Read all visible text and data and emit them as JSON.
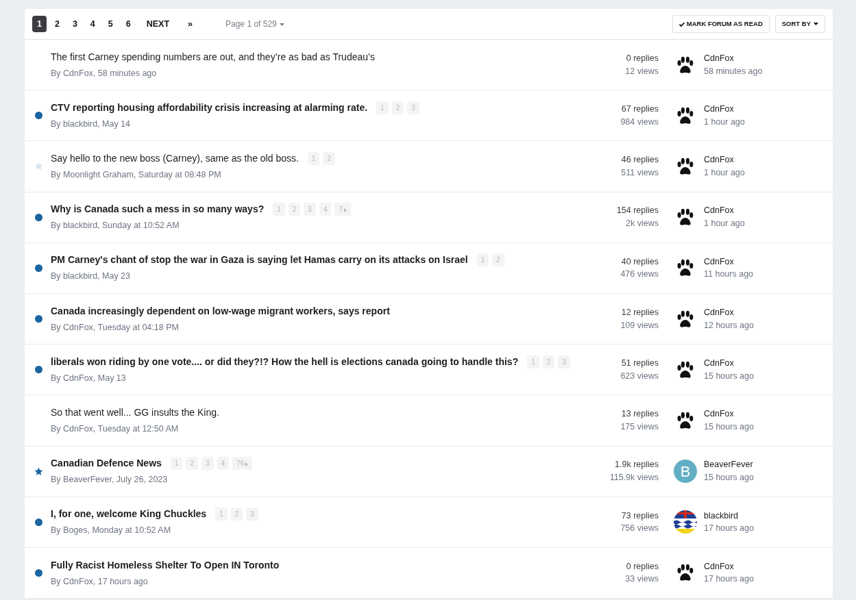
{
  "pagination": {
    "pages": [
      {
        "label": "1",
        "selected": true
      },
      {
        "label": "2",
        "selected": false
      },
      {
        "label": "3",
        "selected": false
      },
      {
        "label": "4",
        "selected": false
      },
      {
        "label": "5",
        "selected": false
      },
      {
        "label": "6",
        "selected": false
      }
    ],
    "next": "NEXT",
    "last": "»",
    "page_jump": "Page 1 of 529"
  },
  "actions": {
    "mark_read": "MARK FORUM AS READ",
    "sort": "SORT BY"
  },
  "topics": [
    {
      "title": "The first Carney spending numbers are out, and they’re as bad as Trudeau’s",
      "unread": false,
      "followed": false,
      "author": "By CdnFox, 58 minutes ago",
      "replies": "0 replies",
      "views": "12 views",
      "avatar": {
        "kind": "paw"
      },
      "last_poster": "CdnFox",
      "last_time": "58 minutes ago"
    },
    {
      "title": "CTV reporting housing affordability crisis increasing at alarming rate.",
      "unread": true,
      "followed": false,
      "author": "By blackbird, May 14",
      "pages": [
        "1",
        "2",
        "3"
      ],
      "replies": "67 replies",
      "views": "984 views",
      "avatar": {
        "kind": "paw"
      },
      "last_poster": "CdnFox",
      "last_time": "1 hour ago"
    },
    {
      "title": "Say hello to the new boss (Carney), same as the old boss.",
      "unread": false,
      "followed": true,
      "author": "By Moonlight Graham, Saturday at 08:48 PM",
      "pages": [
        "1",
        "2"
      ],
      "replies": "46 replies",
      "views": "511 views",
      "avatar": {
        "kind": "paw"
      },
      "last_poster": "CdnFox",
      "last_time": "1 hour ago"
    },
    {
      "title": "Why is Canada such a mess in so many ways?",
      "unread": true,
      "followed": false,
      "author": "By blackbird, Sunday at 10:52 AM",
      "pages": [
        "1",
        "2",
        "3",
        "4"
      ],
      "more_page": "7",
      "replies": "154 replies",
      "views": "2k views",
      "avatar": {
        "kind": "paw"
      },
      "last_poster": "CdnFox",
      "last_time": "1 hour ago"
    },
    {
      "title": "PM Carney's chant of stop the war in Gaza is saying let Hamas carry on its attacks on Israel",
      "unread": true,
      "followed": false,
      "author": "By blackbird, May 23",
      "pages": [
        "1",
        "2"
      ],
      "replies": "40 replies",
      "views": "476 views",
      "avatar": {
        "kind": "paw"
      },
      "last_poster": "CdnFox",
      "last_time": "11 hours ago"
    },
    {
      "title": "Canada increasingly dependent on low-wage migrant workers, says report",
      "unread": true,
      "followed": false,
      "author": "By CdnFox, Tuesday at 04:18 PM",
      "replies": "12 replies",
      "views": "109 views",
      "avatar": {
        "kind": "paw"
      },
      "last_poster": "CdnFox",
      "last_time": "12 hours ago"
    },
    {
      "title": "liberals won riding by one vote.... or did they?!? How the hell is elections canada going to handle this?",
      "unread": true,
      "followed": false,
      "author": "By CdnFox, May 13",
      "pages": [
        "1",
        "2",
        "3"
      ],
      "replies": "51 replies",
      "views": "623 views",
      "avatar": {
        "kind": "paw"
      },
      "last_poster": "CdnFox",
      "last_time": "15 hours ago"
    },
    {
      "title": "So that went well... GG insults the King.",
      "unread": false,
      "followed": false,
      "author": "By CdnFox, Tuesday at 12:50 AM",
      "replies": "13 replies",
      "views": "175 views",
      "avatar": {
        "kind": "paw"
      },
      "last_poster": "CdnFox",
      "last_time": "15 hours ago"
    },
    {
      "title": "Canadian Defence News",
      "unread": true,
      "followed": true,
      "author": "By BeaverFever, July 26, 2023",
      "pages": [
        "1",
        "2",
        "3",
        "4"
      ],
      "more_page": "76",
      "replies": "1.9k replies",
      "views": "115.9k views",
      "avatar": {
        "kind": "letter",
        "letter": "B",
        "color": "#62aec4"
      },
      "last_poster": "BeaverFever",
      "last_time": "15 hours ago"
    },
    {
      "title": "I, for one, welcome King Chuckles",
      "unread": true,
      "followed": false,
      "author": "By Boges, Monday at 10:52 AM",
      "pages": [
        "1",
        "2",
        "3"
      ],
      "replies": "73 replies",
      "views": "756 views",
      "avatar": {
        "kind": "flag"
      },
      "last_poster": "blackbird",
      "last_time": "17 hours ago"
    },
    {
      "title": "Fully Racist Homeless Shelter To Open IN Toronto",
      "unread": true,
      "followed": false,
      "author": "By CdnFox, 17 hours ago",
      "replies": "0 replies",
      "views": "33 views",
      "avatar": {
        "kind": "paw"
      },
      "last_poster": "CdnFox",
      "last_time": "17 hours ago"
    }
  ]
}
